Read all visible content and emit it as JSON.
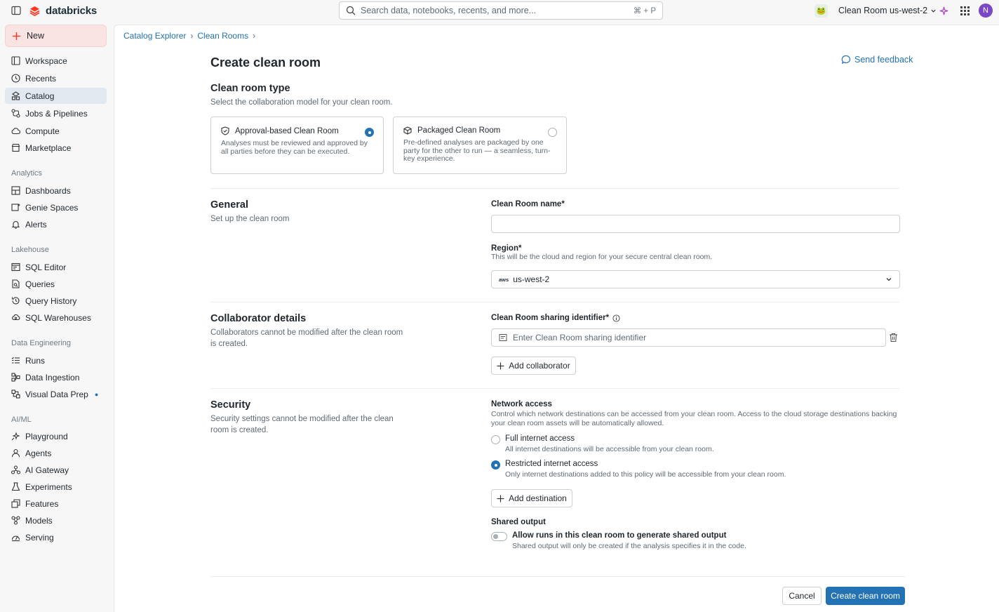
{
  "topbar": {
    "logo_text": "databricks",
    "search_placeholder": "Search data, notebooks, recents, and more...",
    "search_shortcut": "⌘ + P",
    "workspace_name": "Clean Room us-west-2",
    "avatar_initial": "N"
  },
  "sidebar": {
    "new_label": "New",
    "top_items": [
      "Workspace",
      "Recents",
      "Catalog",
      "Jobs & Pipelines",
      "Compute",
      "Marketplace"
    ],
    "analytics_title": "Analytics",
    "analytics_items": [
      "Dashboards",
      "Genie Spaces",
      "Alerts"
    ],
    "lakehouse_title": "Lakehouse",
    "lakehouse_items": [
      "SQL Editor",
      "Queries",
      "Query History",
      "SQL Warehouses"
    ],
    "data_engineering_title": "Data Engineering",
    "data_engineering_items": [
      "Runs",
      "Data Ingestion",
      "Visual Data Prep"
    ],
    "aiml_title": "AI/ML",
    "aiml_items": [
      "Playground",
      "Agents",
      "AI Gateway",
      "Experiments",
      "Features",
      "Models",
      "Serving"
    ],
    "active_item": "Catalog",
    "accent_color": "#2272b4"
  },
  "breadcrumb": [
    "Catalog Explorer",
    "Clean Rooms"
  ],
  "page": {
    "title": "Create clean room",
    "send_feedback": "Send feedback"
  },
  "type_section": {
    "title": "Clean room type",
    "subtitle": "Select the collaboration model for your clean room.",
    "options": [
      {
        "title": "Approval-based Clean Room",
        "description": "Analyses must be reviewed and approved by all parties before they can be executed.",
        "selected": true
      },
      {
        "title": "Packaged Clean Room",
        "description": "Pre-defined analyses are packaged by one party for the other to run — a seamless, turn-key experience.",
        "selected": false
      }
    ]
  },
  "general": {
    "title": "General",
    "subtitle": "Set up the clean room",
    "name_label": "Clean Room name*",
    "name_value": "",
    "region_label": "Region*",
    "region_help": "This will be the cloud and region for your secure central clean room.",
    "region_provider": "aws",
    "region_value": "us-west-2"
  },
  "collaborator": {
    "title": "Collaborator details",
    "subtitle": "Collaborators cannot be modified after the clean room is created.",
    "identifier_label": "Clean Room sharing identifier*",
    "identifier_placeholder": "Enter Clean Room sharing identifier",
    "add_collaborator": "Add collaborator"
  },
  "security": {
    "title": "Security",
    "subtitle": "Security settings cannot be modified after the clean room is created.",
    "network_title": "Network access",
    "network_help": "Control which network destinations can be accessed from your clean room. Access to the cloud storage destinations backing your clean room assets will be automatically allowed.",
    "options": [
      {
        "title": "Full internet access",
        "description": "All internet destinations will be accessible from your clean room.",
        "selected": false
      },
      {
        "title": "Restricted internet access",
        "description": "Only internet destinations added to this policy will be accessible from your clean room.",
        "selected": true
      }
    ],
    "add_destination": "Add destination",
    "shared_output_title": "Shared output",
    "shared_output_toggle": "Allow runs in this clean room to generate shared output",
    "shared_output_help": "Shared output will only be created if the analysis specifies it in the code.",
    "shared_output_enabled": false
  },
  "footer": {
    "cancel": "Cancel",
    "create": "Create clean room"
  }
}
